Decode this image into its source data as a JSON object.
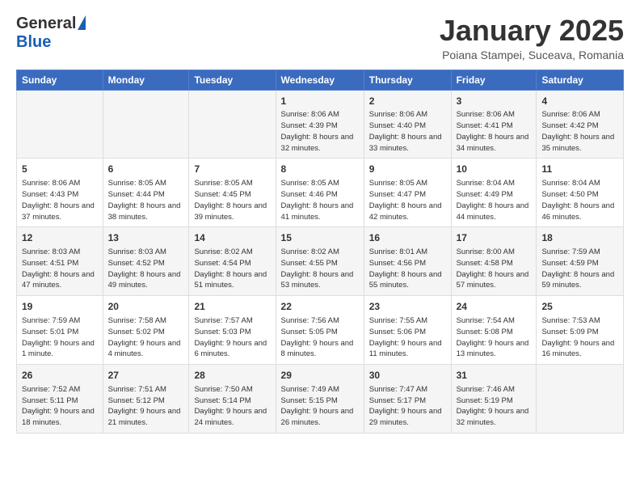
{
  "header": {
    "logo_general": "General",
    "logo_blue": "Blue",
    "month_title": "January 2025",
    "location": "Poiana Stampei, Suceava, Romania"
  },
  "weekdays": [
    "Sunday",
    "Monday",
    "Tuesday",
    "Wednesday",
    "Thursday",
    "Friday",
    "Saturday"
  ],
  "weeks": [
    [
      {
        "day": "",
        "info": ""
      },
      {
        "day": "",
        "info": ""
      },
      {
        "day": "",
        "info": ""
      },
      {
        "day": "1",
        "info": "Sunrise: 8:06 AM\nSunset: 4:39 PM\nDaylight: 8 hours and 32 minutes."
      },
      {
        "day": "2",
        "info": "Sunrise: 8:06 AM\nSunset: 4:40 PM\nDaylight: 8 hours and 33 minutes."
      },
      {
        "day": "3",
        "info": "Sunrise: 8:06 AM\nSunset: 4:41 PM\nDaylight: 8 hours and 34 minutes."
      },
      {
        "day": "4",
        "info": "Sunrise: 8:06 AM\nSunset: 4:42 PM\nDaylight: 8 hours and 35 minutes."
      }
    ],
    [
      {
        "day": "5",
        "info": "Sunrise: 8:06 AM\nSunset: 4:43 PM\nDaylight: 8 hours and 37 minutes."
      },
      {
        "day": "6",
        "info": "Sunrise: 8:05 AM\nSunset: 4:44 PM\nDaylight: 8 hours and 38 minutes."
      },
      {
        "day": "7",
        "info": "Sunrise: 8:05 AM\nSunset: 4:45 PM\nDaylight: 8 hours and 39 minutes."
      },
      {
        "day": "8",
        "info": "Sunrise: 8:05 AM\nSunset: 4:46 PM\nDaylight: 8 hours and 41 minutes."
      },
      {
        "day": "9",
        "info": "Sunrise: 8:05 AM\nSunset: 4:47 PM\nDaylight: 8 hours and 42 minutes."
      },
      {
        "day": "10",
        "info": "Sunrise: 8:04 AM\nSunset: 4:49 PM\nDaylight: 8 hours and 44 minutes."
      },
      {
        "day": "11",
        "info": "Sunrise: 8:04 AM\nSunset: 4:50 PM\nDaylight: 8 hours and 46 minutes."
      }
    ],
    [
      {
        "day": "12",
        "info": "Sunrise: 8:03 AM\nSunset: 4:51 PM\nDaylight: 8 hours and 47 minutes."
      },
      {
        "day": "13",
        "info": "Sunrise: 8:03 AM\nSunset: 4:52 PM\nDaylight: 8 hours and 49 minutes."
      },
      {
        "day": "14",
        "info": "Sunrise: 8:02 AM\nSunset: 4:54 PM\nDaylight: 8 hours and 51 minutes."
      },
      {
        "day": "15",
        "info": "Sunrise: 8:02 AM\nSunset: 4:55 PM\nDaylight: 8 hours and 53 minutes."
      },
      {
        "day": "16",
        "info": "Sunrise: 8:01 AM\nSunset: 4:56 PM\nDaylight: 8 hours and 55 minutes."
      },
      {
        "day": "17",
        "info": "Sunrise: 8:00 AM\nSunset: 4:58 PM\nDaylight: 8 hours and 57 minutes."
      },
      {
        "day": "18",
        "info": "Sunrise: 7:59 AM\nSunset: 4:59 PM\nDaylight: 8 hours and 59 minutes."
      }
    ],
    [
      {
        "day": "19",
        "info": "Sunrise: 7:59 AM\nSunset: 5:01 PM\nDaylight: 9 hours and 1 minute."
      },
      {
        "day": "20",
        "info": "Sunrise: 7:58 AM\nSunset: 5:02 PM\nDaylight: 9 hours and 4 minutes."
      },
      {
        "day": "21",
        "info": "Sunrise: 7:57 AM\nSunset: 5:03 PM\nDaylight: 9 hours and 6 minutes."
      },
      {
        "day": "22",
        "info": "Sunrise: 7:56 AM\nSunset: 5:05 PM\nDaylight: 9 hours and 8 minutes."
      },
      {
        "day": "23",
        "info": "Sunrise: 7:55 AM\nSunset: 5:06 PM\nDaylight: 9 hours and 11 minutes."
      },
      {
        "day": "24",
        "info": "Sunrise: 7:54 AM\nSunset: 5:08 PM\nDaylight: 9 hours and 13 minutes."
      },
      {
        "day": "25",
        "info": "Sunrise: 7:53 AM\nSunset: 5:09 PM\nDaylight: 9 hours and 16 minutes."
      }
    ],
    [
      {
        "day": "26",
        "info": "Sunrise: 7:52 AM\nSunset: 5:11 PM\nDaylight: 9 hours and 18 minutes."
      },
      {
        "day": "27",
        "info": "Sunrise: 7:51 AM\nSunset: 5:12 PM\nDaylight: 9 hours and 21 minutes."
      },
      {
        "day": "28",
        "info": "Sunrise: 7:50 AM\nSunset: 5:14 PM\nDaylight: 9 hours and 24 minutes."
      },
      {
        "day": "29",
        "info": "Sunrise: 7:49 AM\nSunset: 5:15 PM\nDaylight: 9 hours and 26 minutes."
      },
      {
        "day": "30",
        "info": "Sunrise: 7:47 AM\nSunset: 5:17 PM\nDaylight: 9 hours and 29 minutes."
      },
      {
        "day": "31",
        "info": "Sunrise: 7:46 AM\nSunset: 5:19 PM\nDaylight: 9 hours and 32 minutes."
      },
      {
        "day": "",
        "info": ""
      }
    ]
  ]
}
